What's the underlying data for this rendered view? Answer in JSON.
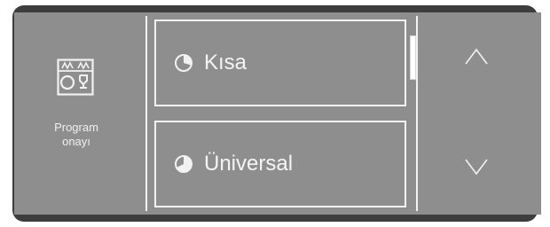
{
  "panel": {
    "program_confirm_label_line1": "Program",
    "program_confirm_label_line2": "onayı",
    "program_confirm_icon": "dishwasher-program-icon"
  },
  "programs": [
    {
      "label": "Kısa",
      "icon": "pie-quarter-icon"
    },
    {
      "label": "Üniversal",
      "icon": "pie-half-icon"
    }
  ],
  "navigation": {
    "up_icon": "chevron-up-icon",
    "down_icon": "chevron-down-icon"
  },
  "colors": {
    "bezel": "#3d3d3d",
    "screen": "#8e8e8e",
    "foreground": "#f2f2f2"
  }
}
